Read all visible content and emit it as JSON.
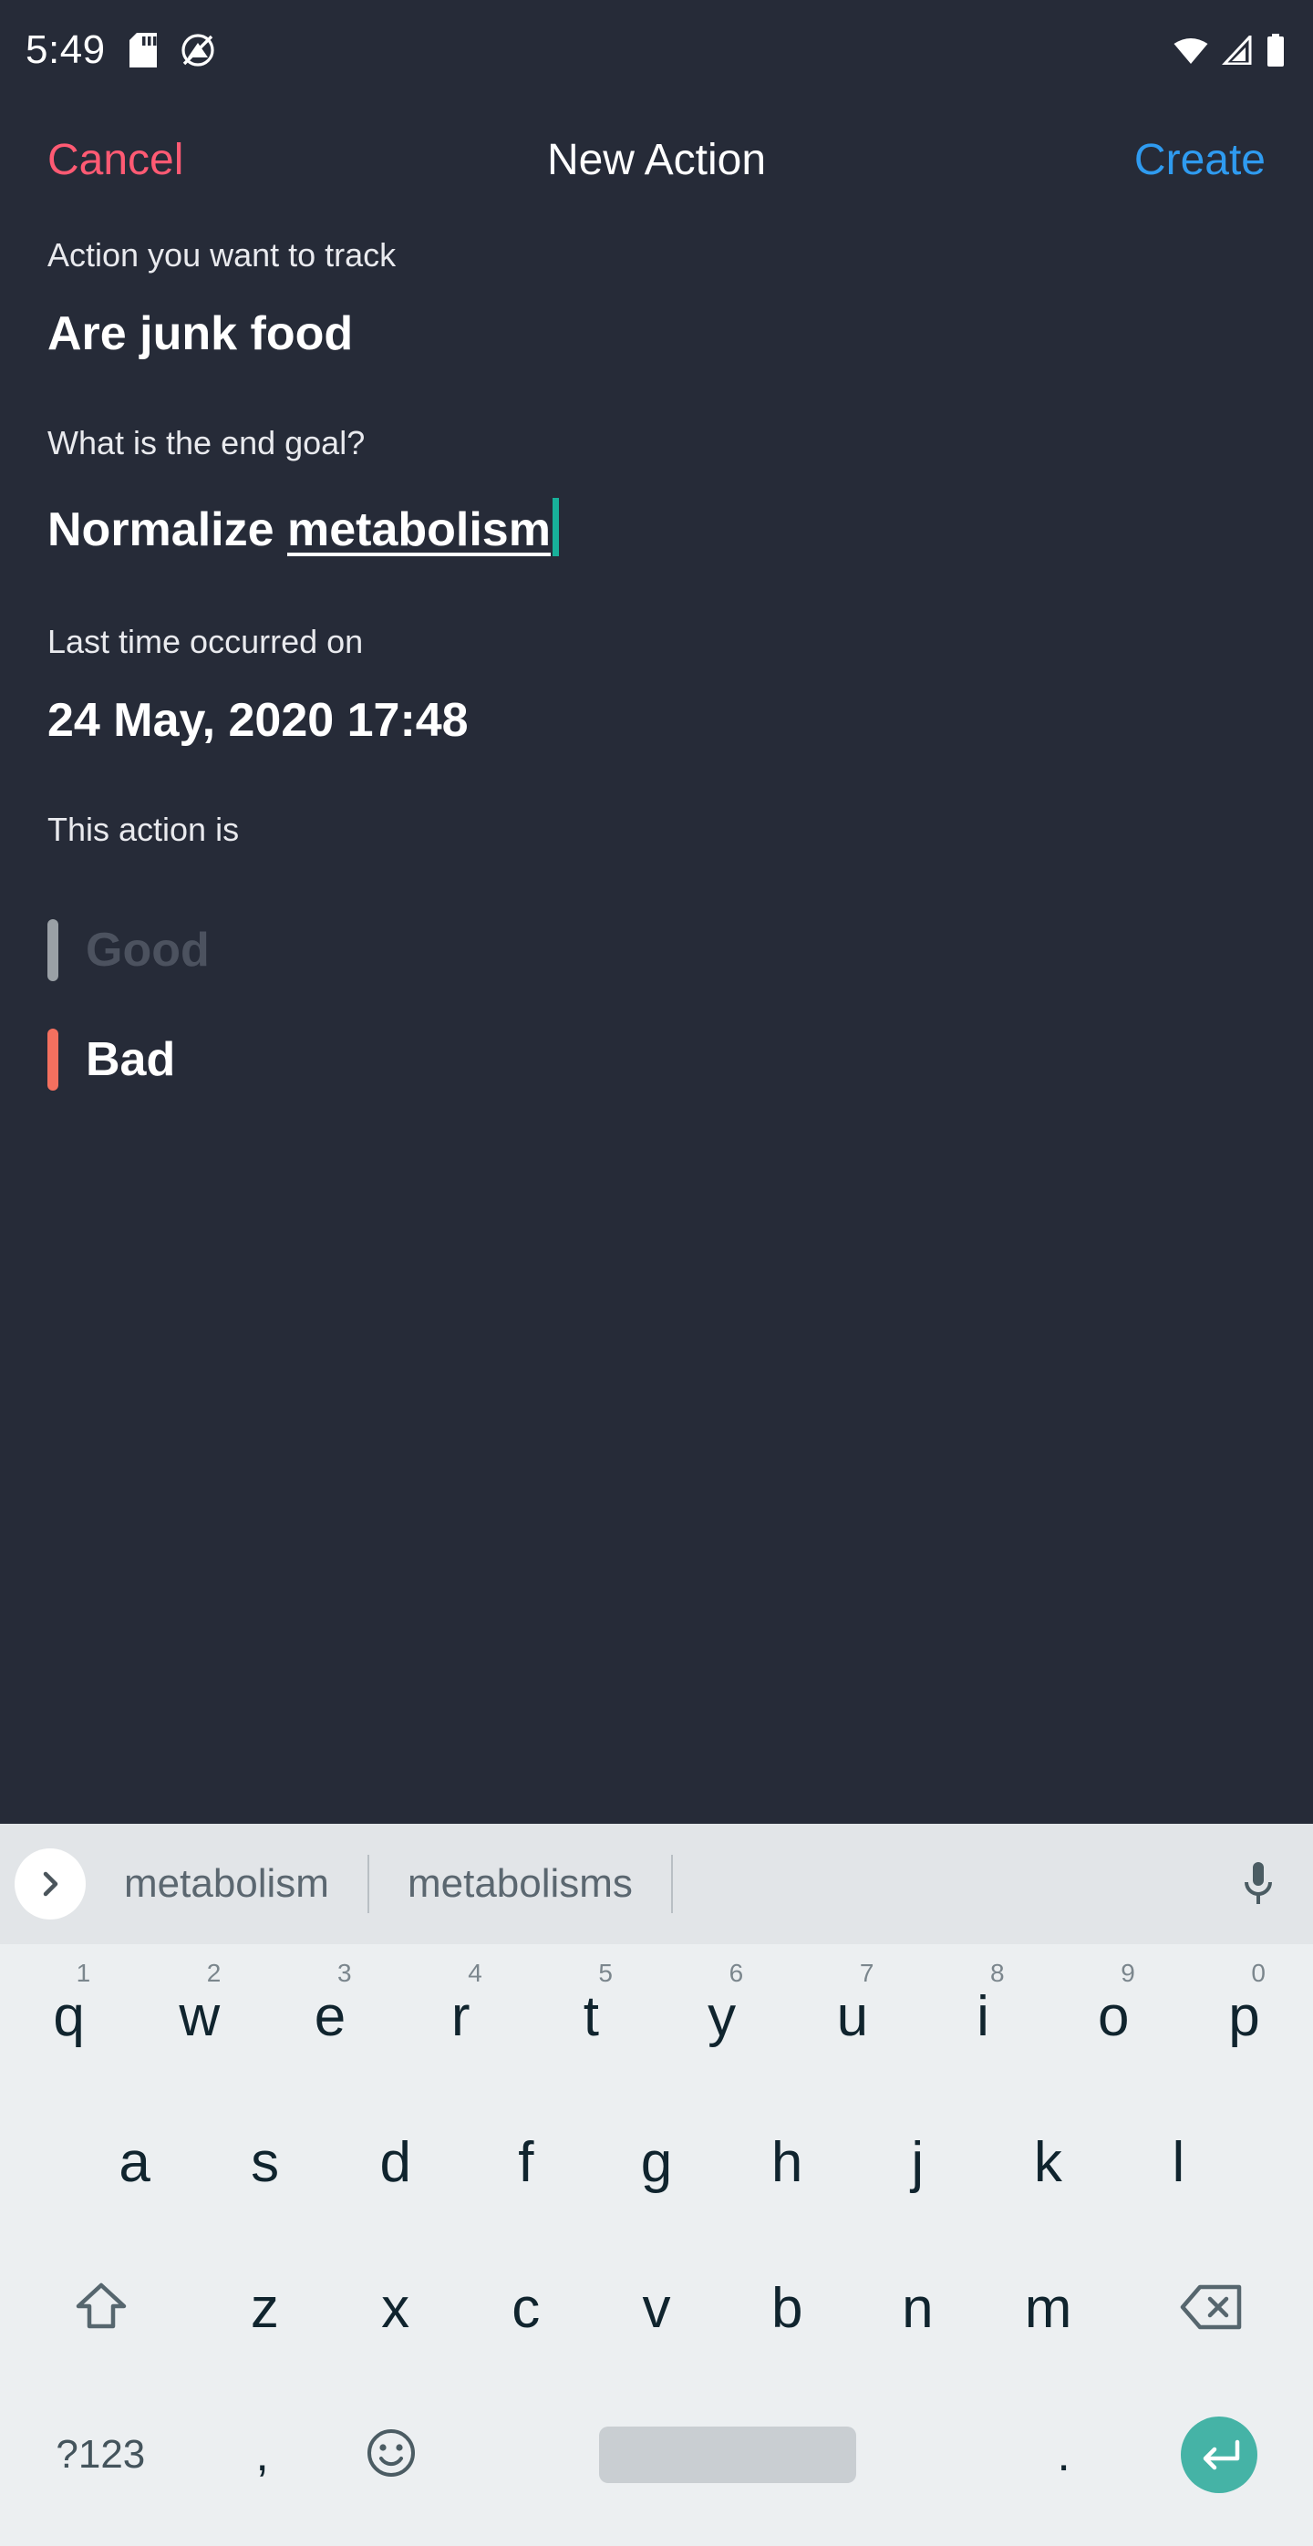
{
  "status_bar": {
    "time": "5:49",
    "left_icons": [
      "sd-card-icon",
      "do-not-disturb-icon"
    ],
    "right_icons": [
      "wifi-icon",
      "cell-signal-icon",
      "battery-icon"
    ]
  },
  "app_bar": {
    "cancel_label": "Cancel",
    "title": "New Action",
    "create_label": "Create",
    "cancel_color": "#ff5a73",
    "create_color": "#2f9bf0"
  },
  "form": {
    "action_label": "Action you want to track",
    "action_value": "Are junk food",
    "goal_label": "What is the end goal?",
    "goal_value_prefix": "Normalize ",
    "goal_value_composing": "metabolism",
    "last_time_label": "Last time occurred on",
    "last_time_value": "24 May, 2020 17:48",
    "type_label": "This action is",
    "caret_color": "#18b09a"
  },
  "choices": [
    {
      "label": "Good",
      "selected": false,
      "bar_color": "#9aa0a6"
    },
    {
      "label": "Bad",
      "selected": true,
      "bar_color": "#f4705f"
    }
  ],
  "keyboard": {
    "expand_icon": "chevron-right-icon",
    "suggestions": [
      "metabolism",
      "metabolisms"
    ],
    "mic_icon": "microphone-icon",
    "row1": [
      {
        "char": "q",
        "num": "1"
      },
      {
        "char": "w",
        "num": "2"
      },
      {
        "char": "e",
        "num": "3"
      },
      {
        "char": "r",
        "num": "4"
      },
      {
        "char": "t",
        "num": "5"
      },
      {
        "char": "y",
        "num": "6"
      },
      {
        "char": "u",
        "num": "7"
      },
      {
        "char": "i",
        "num": "8"
      },
      {
        "char": "o",
        "num": "9"
      },
      {
        "char": "p",
        "num": "0"
      }
    ],
    "row2": [
      "a",
      "s",
      "d",
      "f",
      "g",
      "h",
      "j",
      "k",
      "l"
    ],
    "row3": {
      "shift_icon": "shift-up-arrow-icon",
      "letters": [
        "z",
        "x",
        "c",
        "v",
        "b",
        "n",
        "m"
      ],
      "backspace_icon": "backspace-delete-icon"
    },
    "row4": {
      "symbols_label": "?123",
      "comma": ",",
      "emoji_icon": "smiley-face-icon",
      "space_label": "",
      "period": ".",
      "enter_icon": "enter-return-icon",
      "enter_color": "#45b3a6"
    }
  }
}
